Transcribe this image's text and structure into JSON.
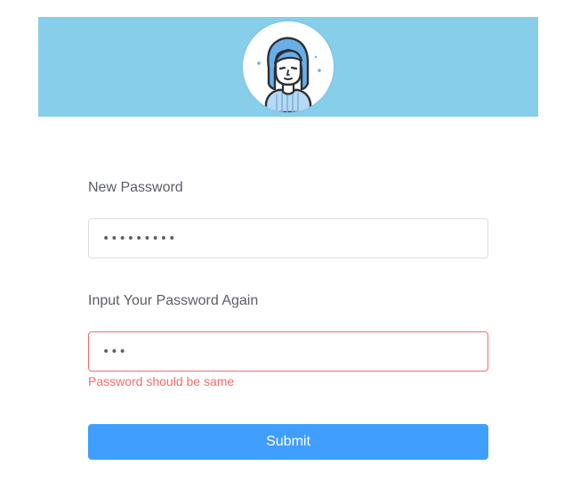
{
  "header": {
    "banner_color": "#87CEEB",
    "avatar_icon": "woman-avatar-icon"
  },
  "form": {
    "new_password": {
      "label": "New Password",
      "value": "•••••••••",
      "input_type": "password"
    },
    "confirm_password": {
      "label": "Input Your Password Again",
      "value": "•••",
      "input_type": "password",
      "error": "Password should be same",
      "error_color": "#f56c6c"
    },
    "submit_label": "Submit",
    "submit_color": "#409EFF"
  }
}
